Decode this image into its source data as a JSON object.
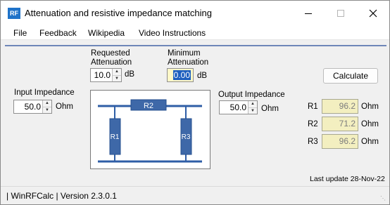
{
  "window": {
    "icon_text": "RF",
    "title": "Attenuation and resistive impedance matching"
  },
  "menu": [
    "File",
    "Feedback",
    "Wikipedia",
    "Video Instructions"
  ],
  "requested_attenuation": {
    "label_line1": "Requested",
    "label_line2": "Attenuation",
    "value": "10.0",
    "unit": "dB"
  },
  "minimum_attenuation": {
    "label_line1": "Minimum",
    "label_line2": "Attenuation",
    "value": "0.00",
    "unit": "dB"
  },
  "input_impedance": {
    "label": "Input Impedance",
    "value": "50.0",
    "unit": "Ohm"
  },
  "output_impedance": {
    "label": "Output Impedance",
    "value": "50.0",
    "unit": "Ohm"
  },
  "calculate_label": "Calculate",
  "diagram": {
    "r1": "R1",
    "r2": "R2",
    "r3": "R3"
  },
  "results": [
    {
      "label": "R1",
      "value": "96.2",
      "unit": "Ohm"
    },
    {
      "label": "R2",
      "value": "71.2",
      "unit": "Ohm"
    },
    {
      "label": "R3",
      "value": "96.2",
      "unit": "Ohm"
    }
  ],
  "last_update": "Last update 28-Nov-22",
  "status": "| WinRFCalc | Version 2.3.0.1",
  "colors": {
    "resistor_fill": "#3e68a8",
    "wire": "#2f5ea6",
    "result_bg": "#f3efc0",
    "selection": "#1e5fbf",
    "rule": "#6e86b8"
  },
  "icons": {
    "minimize": "minimize-icon",
    "maximize": "maximize-icon",
    "close": "close-icon",
    "spin_up": "spin-up-icon",
    "spin_down": "spin-down-icon",
    "app": "app-icon"
  }
}
